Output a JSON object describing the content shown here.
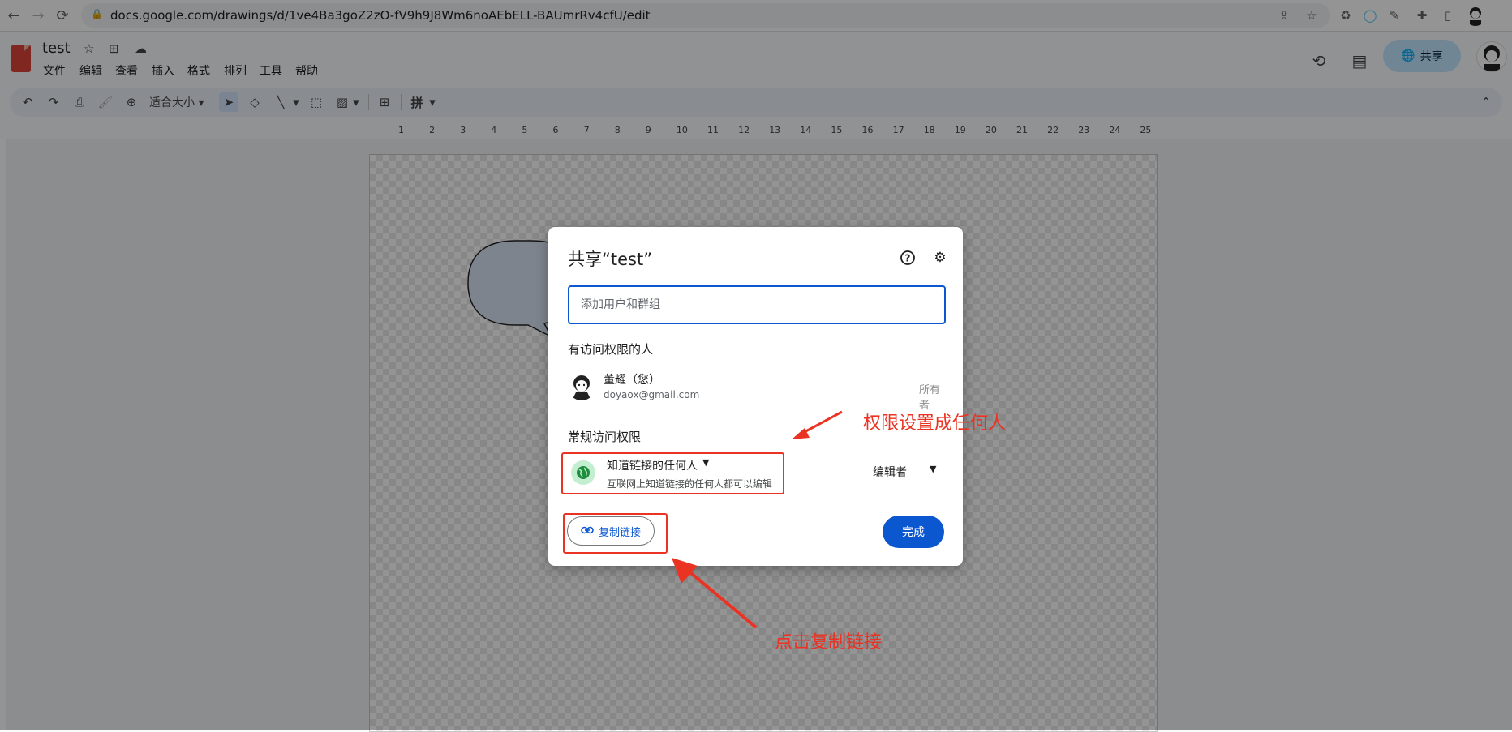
{
  "browser": {
    "url": "docs.google.com/drawings/d/1ve4Ba3goZ2zO-fV9h9J8Wm6noAEbELL-BAUmrRv4cfU/edit"
  },
  "app": {
    "doc_title": "test",
    "menu": [
      "文件",
      "编辑",
      "查看",
      "插入",
      "格式",
      "排列",
      "工具",
      "帮助"
    ],
    "share_label": "共享"
  },
  "toolbar": {
    "zoom_label": "适合大小",
    "input_tool_label": "拼"
  },
  "ruler": {
    "numbers": [
      "1",
      "2",
      "3",
      "4",
      "5",
      "6",
      "7",
      "8",
      "9",
      "10",
      "11",
      "12",
      "13",
      "14",
      "15",
      "16",
      "17",
      "18",
      "19",
      "20",
      "21",
      "22",
      "23",
      "24",
      "25"
    ]
  },
  "dialog": {
    "title": "共享“test”",
    "input_placeholder": "添加用户和群组",
    "people_heading": "有访问权限的人",
    "person": {
      "name": "董耀（您）",
      "email": "doyaox@gmail.com",
      "role": "所有者"
    },
    "general_heading": "常规访问权限",
    "access": {
      "selected": "知道链接的任何人",
      "description": "互联网上知道链接的任何人都可以编辑",
      "role": "编辑者"
    },
    "copy_link_label": "复制链接",
    "done_label": "完成"
  },
  "annotations": {
    "permission_note": "权限设置成任何人",
    "copy_note": "点击复制链接",
    "color": "#ea3323"
  }
}
